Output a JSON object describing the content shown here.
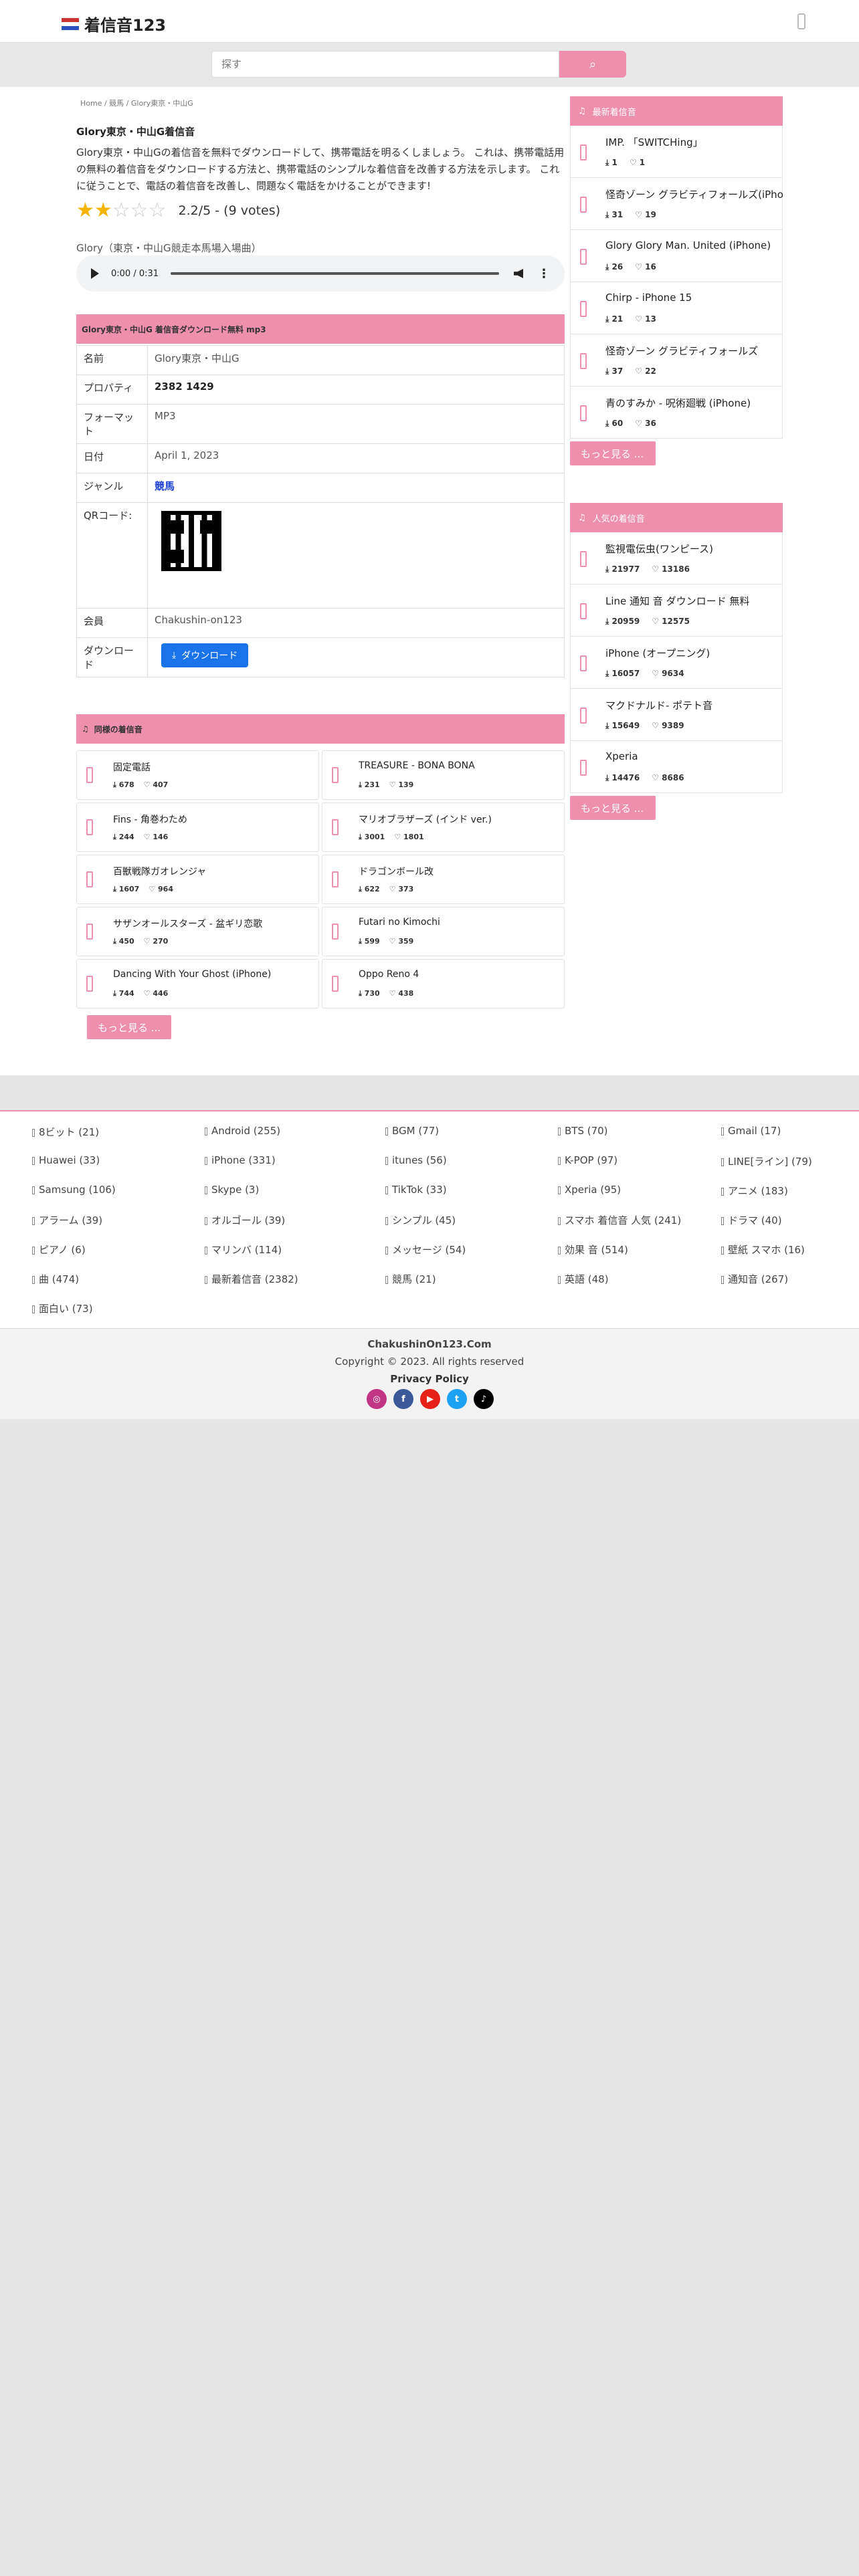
{
  "header": {
    "logo_text": "着信音123"
  },
  "search": {
    "placeholder": "探す"
  },
  "breadcrumb": "Home / 競馬 / Glory東京・中山G",
  "song": {
    "title": "Glory東京・中山G着信音",
    "description": "Glory東京・中山Gの着信音を無料でダウンロードして、携帯電話を明るくしましょう。 これは、携帯電話用の無料の着信音をダウンロードする方法と、携帯電話のシンプルな着信音を改善する方法を示します。 これに従うことで、電話の着信音を改善し、問題なく電話をかけることができます!",
    "rating_text": "2.2/5 - (9 votes)",
    "rating_value": 2.2,
    "audio_title": "Glory（東京・中山G競走本馬場入場曲）",
    "audio_time": "0:00 / 0:31"
  },
  "details": {
    "band_title": "Glory東京・中山G 着信音ダウンロード無料 mp3",
    "rows": [
      {
        "label": "名前",
        "value": "Glory東京・中山G"
      },
      {
        "label": "プロパティ",
        "value": "2382   1429"
      },
      {
        "label": "フォーマット",
        "value": "MP3"
      },
      {
        "label": "日付",
        "value": "April 1, 2023"
      },
      {
        "label": "ジャンル",
        "value": "競馬"
      },
      {
        "label": "QRコード:",
        "value": ""
      },
      {
        "label": "会員",
        "value": "Chakushin-on123"
      },
      {
        "label": "ダウンロード",
        "value": ""
      }
    ],
    "download_label": "ダウンロード"
  },
  "similar": {
    "title": "同様の着信音",
    "items": [
      {
        "name": "固定電話",
        "a": "678",
        "b": "407"
      },
      {
        "name": "TREASURE - BONA BONA",
        "a": "231",
        "b": "139"
      },
      {
        "name": "Fins - 角巻わため",
        "a": "244",
        "b": "146"
      },
      {
        "name": "マリオブラザーズ (インド ver.)",
        "a": "3001",
        "b": "1801"
      },
      {
        "name": "百獣戦隊ガオレンジャ",
        "a": "1607",
        "b": "964"
      },
      {
        "name": "ドラゴンボール改",
        "a": "622",
        "b": "373"
      },
      {
        "name": "サザンオールスターズ - 盆ギリ恋歌",
        "a": "450",
        "b": "270"
      },
      {
        "name": "Futari no Kimochi",
        "a": "599",
        "b": "359"
      },
      {
        "name": "Dancing With Your Ghost (iPhone)",
        "a": "744",
        "b": "446"
      },
      {
        "name": "Oppo Reno 4",
        "a": "730",
        "b": "438"
      }
    ],
    "more_label": "もっと見る ..."
  },
  "sidebar_latest": {
    "title": "最新着信音",
    "items": [
      {
        "name": "IMP. 「SWITCHing」",
        "a": "1",
        "b": "1"
      },
      {
        "name": "怪奇ゾーン グラビティフォールズ(iPhone)",
        "a": "31",
        "b": "19"
      },
      {
        "name": "Glory Glory Man. United (iPhone)",
        "a": "26",
        "b": "16"
      },
      {
        "name": "Chirp - iPhone 15",
        "a": "21",
        "b": "13"
      },
      {
        "name": "怪奇ゾーン グラビティフォールズ",
        "a": "37",
        "b": "22"
      },
      {
        "name": "青のすみか - 呪術廻戦 (iPhone)",
        "a": "60",
        "b": "36"
      }
    ],
    "more_label": "もっと見る ..."
  },
  "sidebar_popular": {
    "title": "人気の着信音",
    "items": [
      {
        "name": "監視電伝虫(ワンピース)",
        "a": "21977",
        "b": "13186"
      },
      {
        "name": "Line 通知 音 ダウンロード 無料",
        "a": "20959",
        "b": "12575"
      },
      {
        "name": "iPhone (オープニング)",
        "a": "16057",
        "b": "9634"
      },
      {
        "name": "マクドナルド- ポテト音",
        "a": "15649",
        "b": "9389"
      },
      {
        "name": "Xperia",
        "a": "14476",
        "b": "8686"
      }
    ],
    "more_label": "もっと見る ..."
  },
  "tags": [
    "8ビット (21)",
    "Android (255)",
    "BGM (77)",
    "BTS (70)",
    "Gmail (17)",
    "Huawei (33)",
    "iPhone (331)",
    "itunes (56)",
    "K-POP (97)",
    "LINE[ライン] (79)",
    "Samsung (106)",
    "Skype (3)",
    "TikTok (33)",
    "Xperia (95)",
    "アニメ (183)",
    "アラーム (39)",
    "オルゴール (39)",
    "シンプル (45)",
    "スマホ 着信音 人気 (241)",
    "ドラマ (40)",
    "ピアノ (6)",
    "マリンバ (114)",
    "メッセージ (54)",
    "効果 音 (514)",
    "壁紙 スマホ (16)",
    "曲 (474)",
    "最新着信音 (2382)",
    "競馬 (21)",
    "英語 (48)",
    "通知音 (267)",
    "面白い (73)"
  ],
  "footer": {
    "site": "ChakushinOn123.Com",
    "copyright": "Copyright © 2023. All rights reserved",
    "privacy": "Privacy Policy"
  },
  "colors": {
    "accent": "#ee8fae",
    "download": "#1a73e8",
    "star": "#f5b400"
  }
}
